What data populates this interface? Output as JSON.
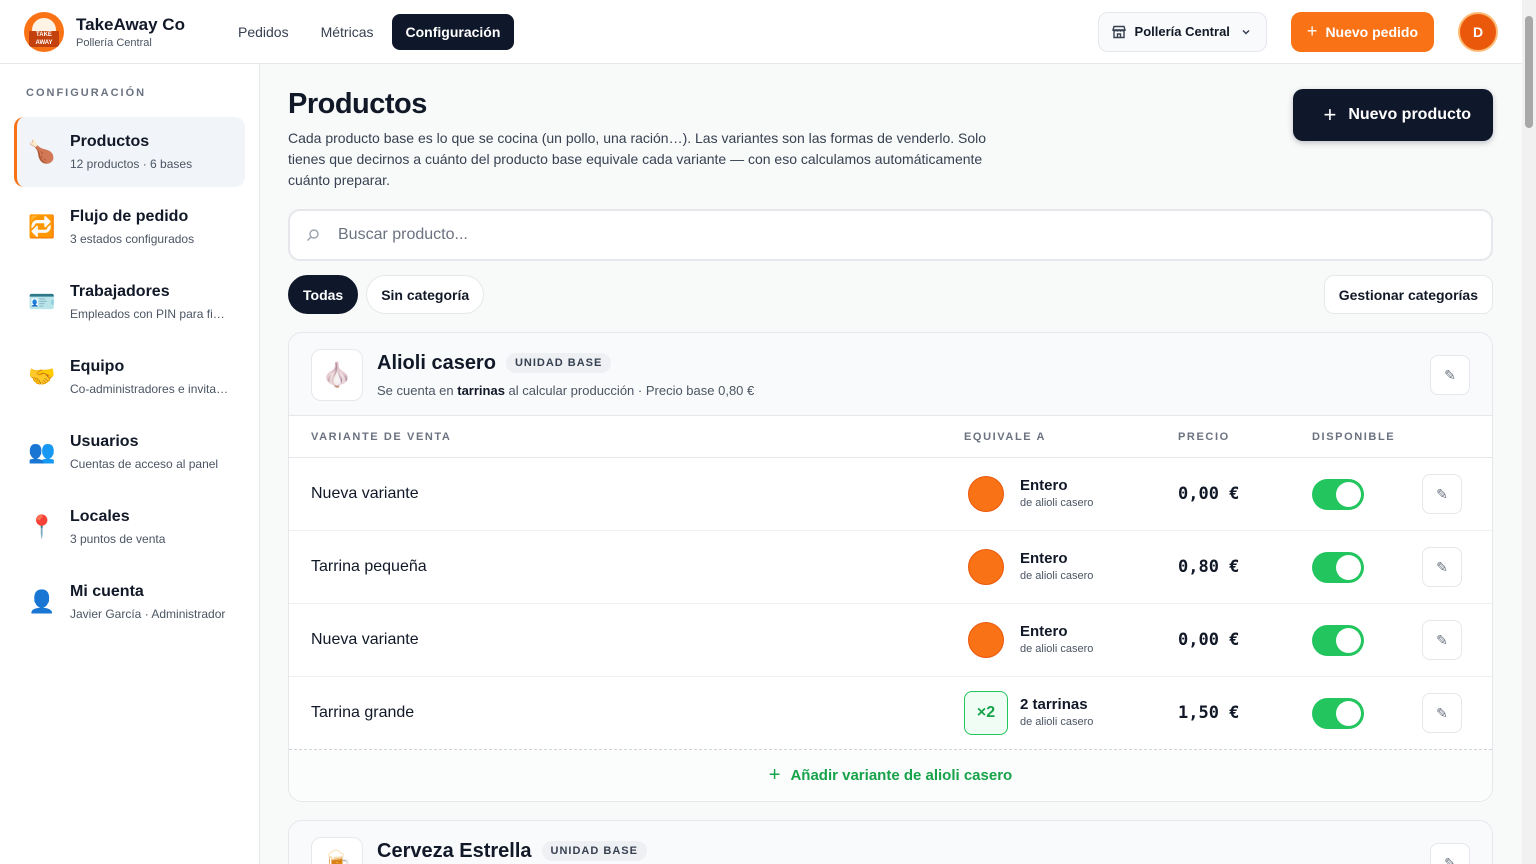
{
  "brand": {
    "name": "TakeAway Co",
    "subtitle": "Pollería Central",
    "logo_text": "TAKE AWAY"
  },
  "nav": {
    "items": [
      "Pedidos",
      "Métricas",
      "Configuración"
    ],
    "active": 2
  },
  "header": {
    "store_selector": "Pollería Central",
    "new_order_label": "Nuevo pedido",
    "new_order_plus": "+",
    "avatar_initial": "D",
    "accent_color": "#f97316"
  },
  "sidebar": {
    "title": "CONFIGURACIÓN",
    "items": [
      {
        "icon": "🍗",
        "icon_name": "chicken-leg-icon",
        "label": "Productos",
        "sub": "12 productos · 6 bases"
      },
      {
        "icon": "🔁",
        "icon_name": "repeat-icon",
        "label": "Flujo de pedido",
        "sub": "3 estados configurados"
      },
      {
        "icon": "🪪",
        "icon_name": "id-card-icon",
        "label": "Trabajadores",
        "sub": "Empleados con PIN para fichar"
      },
      {
        "icon": "🤝",
        "icon_name": "handshake-icon",
        "label": "Equipo",
        "sub": "Co-administradores e invitados"
      },
      {
        "icon": "👥",
        "icon_name": "users-icon",
        "label": "Usuarios",
        "sub": "Cuentas de acceso al panel"
      },
      {
        "icon": "📍",
        "icon_name": "location-pin-icon",
        "label": "Locales",
        "sub": "3 puntos de venta"
      },
      {
        "icon": "👤",
        "icon_name": "user-icon",
        "label": "Mi cuenta",
        "sub": "Javier García · Administrador"
      }
    ]
  },
  "page": {
    "title": "Productos",
    "description": "Cada producto base es lo que se cocina (un pollo, una ración…). Las variantes son las formas de venderlo. Solo tienes que decirnos a cuánto del producto base equivale cada variante — con eso calculamos automáticamente cuánto preparar.",
    "new_product_label": "Nuevo producto",
    "new_product_plus": "+"
  },
  "search": {
    "placeholder": "Buscar producto...",
    "value": ""
  },
  "filters": {
    "chips": [
      "Todas",
      "Sin categoría"
    ],
    "active": 0,
    "manage_label": "Gestionar categorías"
  },
  "table_headers": {
    "variant": "VARIANTE DE VENTA",
    "equiv": "EQUIVALE A",
    "price": "PRECIO",
    "available": "DISPONIBLE"
  },
  "products": [
    {
      "icon": "🧄",
      "icon_name": "garlic-icon",
      "name": "Alioli casero",
      "badge": "UNIDAD BASE",
      "sub_pre": "Se cuenta en ",
      "sub_unit": "tarrinas",
      "sub_post": " al calcular producción · Precio base 0,80 €",
      "variants": [
        {
          "name": "Nueva variante",
          "equiv_type": "whole",
          "equiv_title": "Entero",
          "equiv_sub": "de alioli casero",
          "price": "0,00 €",
          "available": true
        },
        {
          "name": "Tarrina pequeña",
          "equiv_type": "whole",
          "equiv_title": "Entero",
          "equiv_sub": "de alioli casero",
          "price": "0,80 €",
          "available": true
        },
        {
          "name": "Nueva variante",
          "equiv_type": "whole",
          "equiv_title": "Entero",
          "equiv_sub": "de alioli casero",
          "price": "0,00 €",
          "available": true
        },
        {
          "name": "Tarrina grande",
          "equiv_type": "multiple",
          "equiv_badge": "×2",
          "equiv_title": "2 tarrinas",
          "equiv_sub": "de alioli casero",
          "price": "1,50 €",
          "available": true
        }
      ],
      "add_variant_label": "Añadir variante de alioli casero",
      "add_variant_plus": "+"
    },
    {
      "icon": "🍺",
      "icon_name": "beer-icon",
      "name": "Cerveza Estrella",
      "badge": "UNIDAD BASE"
    }
  ]
}
